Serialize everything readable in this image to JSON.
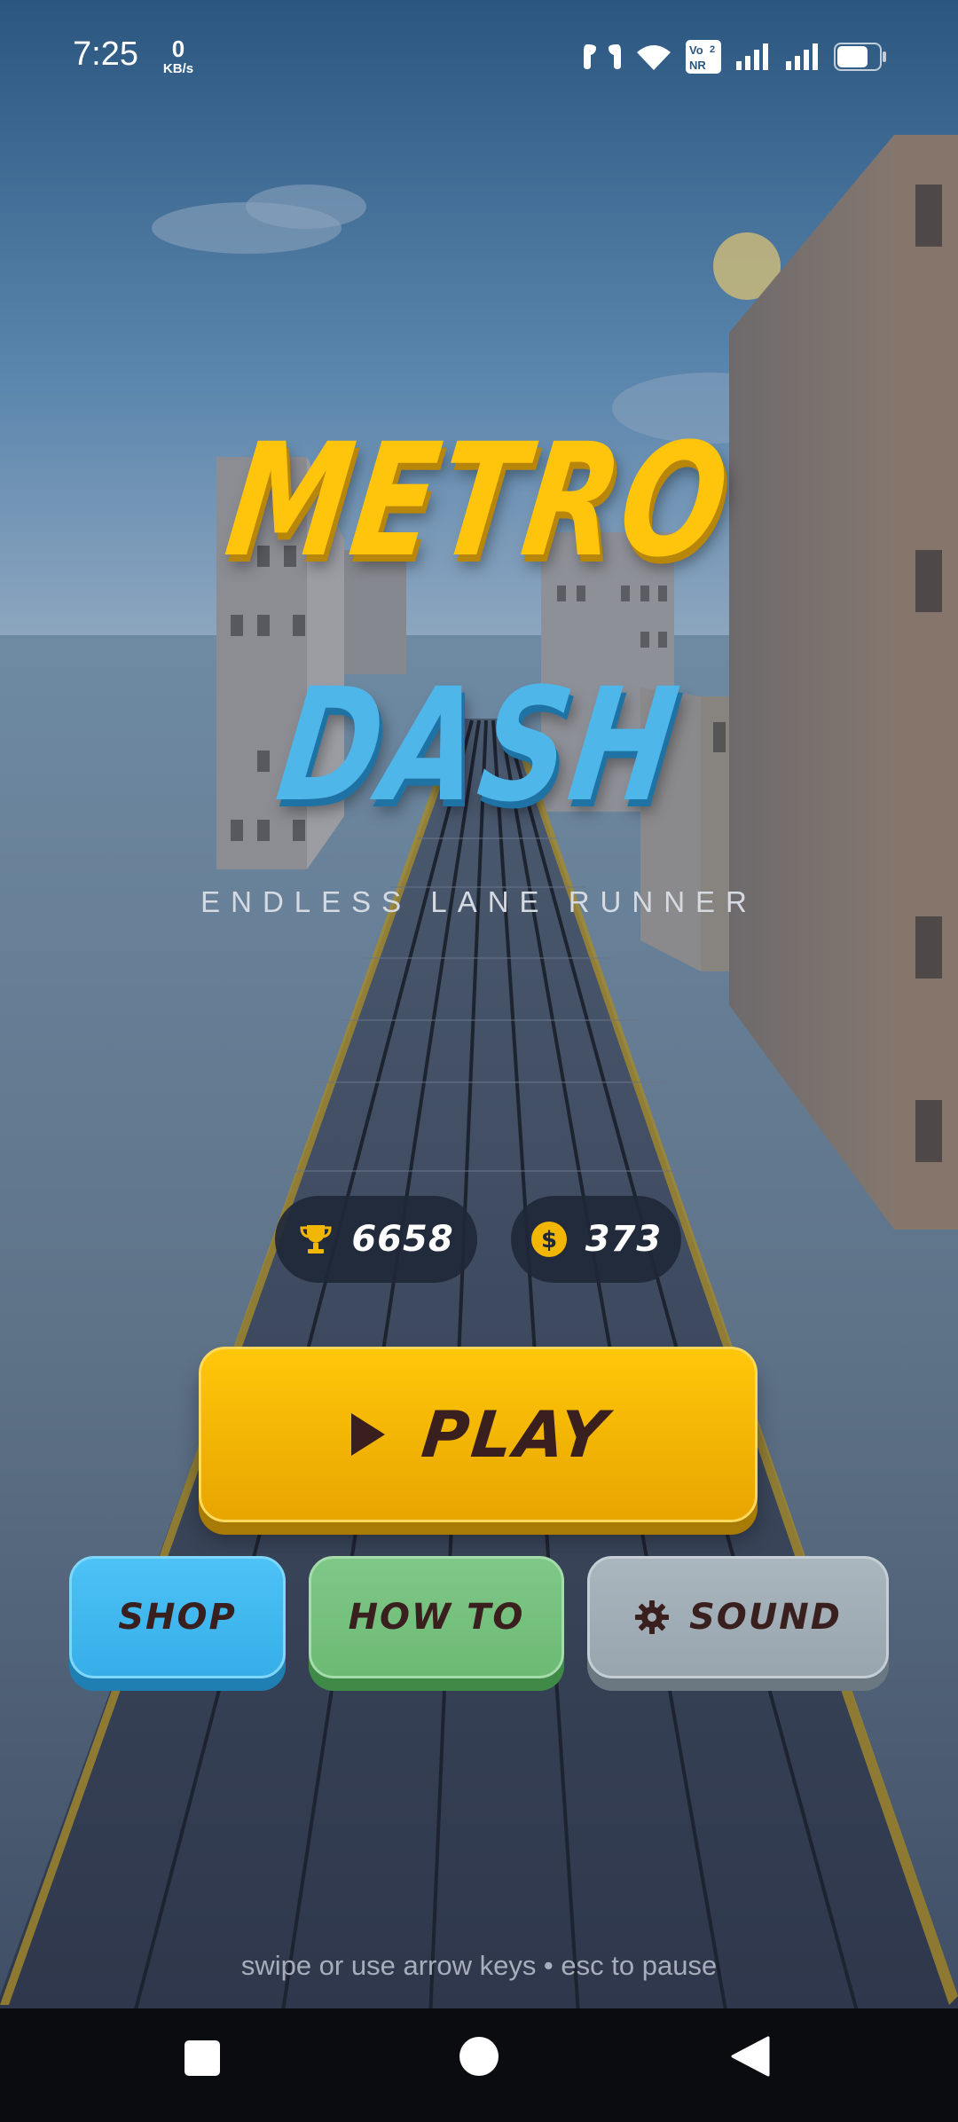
{
  "status_bar": {
    "time": "7:25",
    "net_speed_value": "0",
    "net_speed_unit": "KB/s",
    "volte_label_1": "Vo",
    "volte_label_2": "NR",
    "sim_label": "2",
    "icons": [
      "earbuds-icon",
      "wifi-icon",
      "volte-nr-icon",
      "signal-sim1-icon",
      "signal-sim2-icon",
      "battery-icon"
    ]
  },
  "game": {
    "title_line1": "METRO",
    "title_line2": "DASH",
    "subtitle": "ENDLESS LANE RUNNER",
    "best_score": "6658",
    "coins": "373",
    "play_label": "PLAY",
    "shop_label": "SHOP",
    "howto_label": "HOW TO",
    "sound_label": "SOUND",
    "hint_text": "swipe or use arrow keys  •  esc to pause"
  },
  "navigation_bar": {
    "buttons": [
      "recents-button",
      "home-button",
      "back-button"
    ]
  },
  "colors": {
    "title_yellow": "#ffc40c",
    "title_blue": "#4fb6ea",
    "play_yellow": "#ffc70a",
    "shop_blue": "#37aee8",
    "howto_green": "#6cba74",
    "sound_gray": "#98a5ae",
    "button_text": "#3a1f1f"
  }
}
